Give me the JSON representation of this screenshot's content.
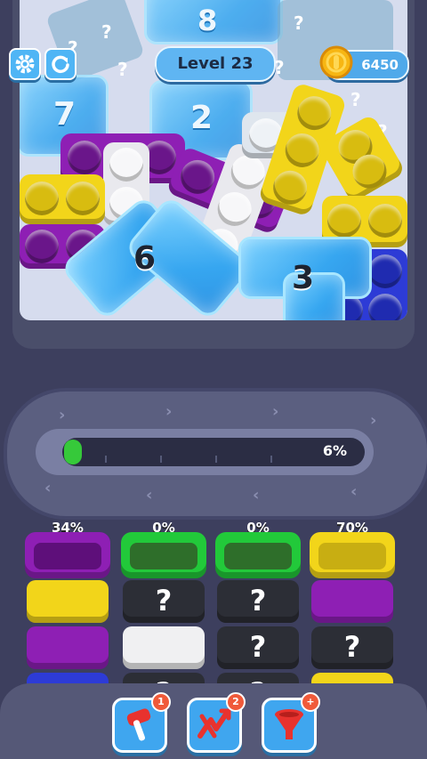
{
  "header": {
    "level_label": "Level 23",
    "coins": "6450"
  },
  "icons": {
    "settings": "gear-icon",
    "restart": "restart-icon",
    "coin": "coin-icon"
  },
  "board": {
    "hidden_numbers": [
      "8",
      "7",
      "2"
    ],
    "numbers": [
      "6",
      "3"
    ],
    "hidden_marks": [
      "?",
      "?",
      "?",
      "?",
      "?",
      "?",
      "?"
    ]
  },
  "conveyor": {
    "progress_percent": 6,
    "progress_label": "6%"
  },
  "bins": {
    "columns": [
      {
        "percent_label": "34%",
        "top_color": "#8e1fb4",
        "stack": [
          "#f2d51a",
          "#8e1fb4",
          "#2d3bd6"
        ]
      },
      {
        "percent_label": "0%",
        "top_color": "#22c93a",
        "stack": [
          "?",
          "#ffffff",
          "?"
        ]
      },
      {
        "percent_label": "0%",
        "top_color": "#22c93a",
        "stack": [
          "?",
          "?",
          "?"
        ]
      },
      {
        "percent_label": "70%",
        "top_color": "#f2d51a",
        "stack": [
          "#8e1fb4",
          "?",
          "#f2d51a"
        ]
      }
    ],
    "question_mark": "?"
  },
  "tools": [
    {
      "icon": "hammer-icon",
      "count": "1"
    },
    {
      "icon": "shuffle-icon",
      "count": "2"
    },
    {
      "icon": "funnel-icon",
      "count": "+"
    }
  ],
  "colors": {
    "purple": "#8e1fb4",
    "yellow": "#f2d51a",
    "blue": "#2d3bd6",
    "white": "#f0f0f2",
    "green": "#22c93a",
    "jelly": "#36a6f0"
  }
}
